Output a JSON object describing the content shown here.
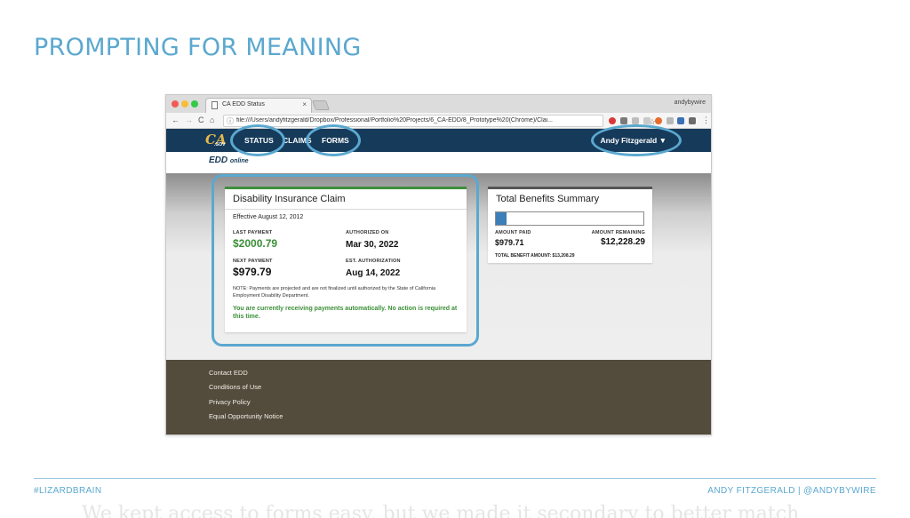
{
  "slide": {
    "title": "PROMPTING FOR MEANING",
    "footer_left": "#LIZARDBRAIN",
    "footer_right": "ANDY FITZGERALD | @ANDYBYWIRE",
    "ghost_caption": "We kept access to forms easy, but we made it secondary to better match"
  },
  "browser": {
    "tab_title": "CA EDD Status",
    "tab_close": "×",
    "profile_name": "andybywire",
    "nav_back": "←",
    "nav_forward": "→",
    "nav_reload": "C",
    "nav_home": "⌂",
    "info_icon": "ⓘ",
    "url": "file:///Users/andyfitzgerald/Dropbox/Professional/Portfolio%20Projects/6_CA-EDD/8_Prototype%20(Chrome)/Clai...",
    "star": "☆",
    "menu": "⋮"
  },
  "site": {
    "logo_ca": "CA",
    "logo_gov": ".GOV",
    "nav": {
      "status": "STATUS",
      "claims": "CLAIMS",
      "forms": "FORMS"
    },
    "user_name": "Andy Fitzgerald ▼",
    "edd_logo": "EDD",
    "edd_logo_suffix": "online"
  },
  "disability_card": {
    "title": "Disability Insurance Claim",
    "effective": "Effective August 12, 2012",
    "last_payment_label": "LAST PAYMENT",
    "last_payment_value": "$2000.79",
    "authorized_on_label": "AUTHORIZED ON",
    "authorized_on_value": "Mar 30, 2022",
    "next_payment_label": "NEXT PAYMENT",
    "next_payment_value": "$979.79",
    "est_authorization_label": "EST. AUTHORIZATION",
    "est_authorization_value": "Aug 14, 2022",
    "note": "NOTE: Payments are projected and are not finalized until authorized by the State of California Employment Disability Department.",
    "status_message": "You are currently receiving payments automatically. No action is required at this time."
  },
  "benefits_card": {
    "title": "Total Benefits Summary",
    "progress_fraction": 0.074,
    "amount_paid_label": "AMOUNT PAID",
    "amount_paid_value": "$979.71",
    "amount_remaining_label": "AMOUNT REMAINING",
    "amount_remaining_value": "$12,228.29",
    "total_label": "TOTAL BENEFIT AMOUNT:",
    "total_value": "$13,208.29"
  },
  "footer_links": {
    "contact": "Contact EDD",
    "conditions": "Conditions of Use",
    "privacy": "Privacy Policy",
    "equal_opportunity": "Equal Opportunity Notice"
  },
  "colors": {
    "accent": "#5ba8cf",
    "nav_bg": "#163a5a",
    "success": "#3b8f36",
    "footer_bg": "#534b3b",
    "progress": "#3d7fb8"
  }
}
